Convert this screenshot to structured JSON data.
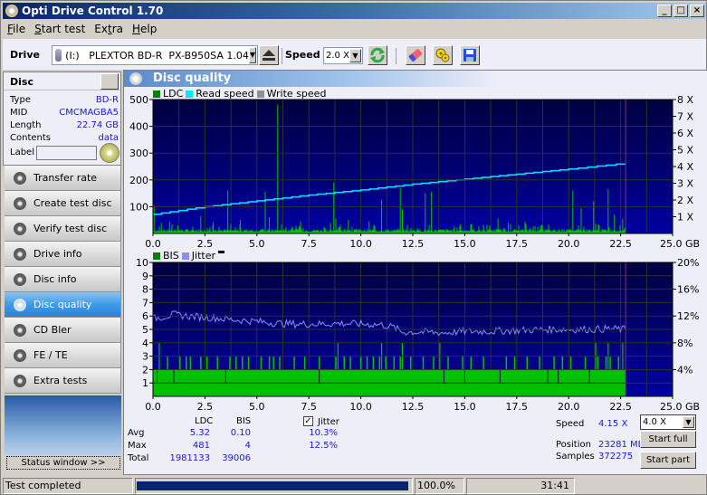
{
  "window": {
    "title": "Opti Drive Control 1.70",
    "controls": [
      "_",
      "□",
      "×"
    ]
  },
  "menu": [
    {
      "label": "File",
      "accel": "F"
    },
    {
      "label": "Start test",
      "accel": "S"
    },
    {
      "label": "Extra",
      "accel": "t"
    },
    {
      "label": "Help",
      "accel": "H"
    }
  ],
  "toolbar": {
    "drive_label": "Drive",
    "drive_value": "(I:)   PLEXTOR BD-R  PX-B950SA 1.04",
    "speed_label": "Speed",
    "speed_value": "2.0 X",
    "icons": [
      "eject-icon",
      "refresh-icon",
      "eraser-icon",
      "settings-icon",
      "save-icon"
    ]
  },
  "disc": {
    "header": "Disc",
    "rows": [
      {
        "key": "Type",
        "value": "BD-R"
      },
      {
        "key": "MID",
        "value": "CMCMAGBA5"
      },
      {
        "key": "Length",
        "value": "22.74 GB"
      },
      {
        "key": "Contents",
        "value": "data"
      }
    ],
    "label_key": "Label",
    "label_value": ""
  },
  "nav": [
    {
      "label": "Transfer rate",
      "active": false
    },
    {
      "label": "Create test disc",
      "active": false
    },
    {
      "label": "Verify test disc",
      "active": false
    },
    {
      "label": "Drive info",
      "active": false
    },
    {
      "label": "Disc info",
      "active": false
    },
    {
      "label": "Disc quality",
      "active": true
    },
    {
      "label": "CD Bler",
      "active": false
    },
    {
      "label": "FE / TE",
      "active": false
    },
    {
      "label": "Extra tests",
      "active": false
    }
  ],
  "status_window_label": "Status window >>",
  "panel_title": "Disc quality",
  "colors": {
    "ldc": "#00c000",
    "read_speed": "#00e8ff",
    "write_speed": "#909090",
    "bis": "#00c000",
    "jitter": "#8c8cff",
    "plot_bg_top": "#000040",
    "plot_bg_bottom": "#0000a0",
    "end_marker": "#a02080",
    "accent": "#3d9ae8"
  },
  "chart_data": [
    {
      "type": "bar",
      "title": "LDC / Read speed",
      "legend": [
        "LDC",
        "Read speed",
        "Write speed"
      ],
      "legend_position": "top-left",
      "xlabel": "GB",
      "xlim": [
        0,
        25
      ],
      "xticks": [
        "0.0",
        "2.5",
        "5.0",
        "7.5",
        "10.0",
        "12.5",
        "15.0",
        "17.5",
        "20.0",
        "22.5",
        "25.0 GB"
      ],
      "ylim_left": [
        0,
        500
      ],
      "yticks_left": [
        "100",
        "200",
        "300",
        "400",
        "500"
      ],
      "ylim_right": [
        0,
        8
      ],
      "yticks_right": [
        "1 X",
        "2 X",
        "3 X",
        "4 X",
        "5 X",
        "6 X",
        "7 X",
        "8 X"
      ],
      "grid": true,
      "data_end_gb": 22.74,
      "ldc_baseline": 12,
      "ldc_spikes": [
        {
          "x": 0.05,
          "y": 105
        },
        {
          "x": 0.4,
          "y": 40
        },
        {
          "x": 0.8,
          "y": 45
        },
        {
          "x": 1.2,
          "y": 30
        },
        {
          "x": 2.3,
          "y": 65
        },
        {
          "x": 2.9,
          "y": 42
        },
        {
          "x": 3.6,
          "y": 160
        },
        {
          "x": 4.2,
          "y": 50
        },
        {
          "x": 5.4,
          "y": 155
        },
        {
          "x": 5.6,
          "y": 60
        },
        {
          "x": 6.0,
          "y": 481
        },
        {
          "x": 7.1,
          "y": 45
        },
        {
          "x": 8.7,
          "y": 190
        },
        {
          "x": 8.8,
          "y": 55
        },
        {
          "x": 9.4,
          "y": 50
        },
        {
          "x": 10.4,
          "y": 45
        },
        {
          "x": 11.0,
          "y": 125
        },
        {
          "x": 11.9,
          "y": 170
        },
        {
          "x": 12.0,
          "y": 90
        },
        {
          "x": 13.1,
          "y": 150
        },
        {
          "x": 13.4,
          "y": 155
        },
        {
          "x": 14.8,
          "y": 35
        },
        {
          "x": 16.6,
          "y": 55
        },
        {
          "x": 17.1,
          "y": 40
        },
        {
          "x": 17.9,
          "y": 45
        },
        {
          "x": 18.7,
          "y": 30
        },
        {
          "x": 20.2,
          "y": 160
        },
        {
          "x": 20.6,
          "y": 95
        },
        {
          "x": 21.2,
          "y": 120
        },
        {
          "x": 21.9,
          "y": 165
        },
        {
          "x": 22.2,
          "y": 70
        },
        {
          "x": 22.6,
          "y": 55
        }
      ],
      "read_speed": [
        {
          "x": 0,
          "y": 1.15
        },
        {
          "x": 2.5,
          "y": 1.6
        },
        {
          "x": 5,
          "y": 1.95
        },
        {
          "x": 7.5,
          "y": 2.3
        },
        {
          "x": 10,
          "y": 2.6
        },
        {
          "x": 12.5,
          "y": 2.95
        },
        {
          "x": 15,
          "y": 3.25
        },
        {
          "x": 17.5,
          "y": 3.55
        },
        {
          "x": 20,
          "y": 3.85
        },
        {
          "x": 22.74,
          "y": 4.2
        }
      ]
    },
    {
      "type": "bar",
      "title": "BIS / Jitter",
      "legend": [
        "BIS",
        "Jitter"
      ],
      "legend_position": "top-left",
      "xlabel": "GB",
      "xlim": [
        0,
        25
      ],
      "xticks": [
        "0.0",
        "2.5",
        "5.0",
        "7.5",
        "10.0",
        "12.5",
        "15.0",
        "17.5",
        "20.0",
        "22.5",
        "25.0 GB"
      ],
      "ylim_left": [
        0,
        10
      ],
      "yticks_left": [
        "1",
        "2",
        "3",
        "4",
        "5",
        "6",
        "7",
        "8",
        "9",
        "10"
      ],
      "ylim_right": [
        0,
        20
      ],
      "yticks_right": [
        "4%",
        "8%",
        "12%",
        "16%",
        "20%"
      ],
      "grid": true,
      "data_end_gb": 22.74,
      "bis_baseline": 2,
      "bis_spikes_3": [
        0.7,
        1.3,
        1.6,
        1.8,
        2.3,
        2.6,
        3.1,
        3.7,
        4.0,
        4.3,
        4.6,
        5.2,
        5.6,
        5.8,
        6.1,
        6.8,
        7.3,
        8.0,
        8.8,
        9.2,
        9.5,
        10.0,
        10.3,
        10.6,
        10.9,
        11.2,
        11.6,
        11.9,
        12.4,
        13.0,
        13.5,
        14.2,
        14.9,
        15.3,
        15.9,
        17.0,
        17.4,
        18.0,
        18.6,
        19.3,
        19.7,
        20.1,
        20.8,
        21.4,
        21.8,
        22.0,
        22.4
      ],
      "bis_spikes_4": [
        0.3,
        8.9,
        11.0,
        12.0,
        13.8,
        21.3,
        21.9,
        22.6
      ],
      "bis_zero_dips": [
        0.2,
        1.0,
        3.5,
        8.0,
        14.0,
        15.0,
        16.7,
        19.0,
        19.5,
        21.0
      ],
      "jitter": [
        {
          "x": 0,
          "y": 11.6
        },
        {
          "x": 1,
          "y": 12.2
        },
        {
          "x": 2,
          "y": 11.9
        },
        {
          "x": 3,
          "y": 11.7
        },
        {
          "x": 4,
          "y": 11.4
        },
        {
          "x": 5,
          "y": 11.2
        },
        {
          "x": 6,
          "y": 10.9
        },
        {
          "x": 7,
          "y": 10.8
        },
        {
          "x": 8,
          "y": 10.8
        },
        {
          "x": 9,
          "y": 10.9
        },
        {
          "x": 10,
          "y": 10.8
        },
        {
          "x": 11,
          "y": 10.7
        },
        {
          "x": 11.6,
          "y": 10.3
        },
        {
          "x": 12,
          "y": 9.6
        },
        {
          "x": 13,
          "y": 9.6
        },
        {
          "x": 14,
          "y": 9.5
        },
        {
          "x": 15,
          "y": 9.7
        },
        {
          "x": 16,
          "y": 9.7
        },
        {
          "x": 17,
          "y": 9.8
        },
        {
          "x": 18,
          "y": 9.9
        },
        {
          "x": 19,
          "y": 10.0
        },
        {
          "x": 20,
          "y": 10.0
        },
        {
          "x": 21,
          "y": 10.0
        },
        {
          "x": 22,
          "y": 10.1
        },
        {
          "x": 22.74,
          "y": 10.0
        }
      ]
    }
  ],
  "stats": {
    "col_ldc": "LDC",
    "col_bis": "BIS",
    "jitter_label": "Jitter",
    "jitter_checked": true,
    "rows": [
      {
        "label": "Avg",
        "ldc": "5.32",
        "bis": "0.10",
        "jitter": "10.3%"
      },
      {
        "label": "Max",
        "ldc": "481",
        "bis": "4",
        "jitter": "12.5%"
      },
      {
        "label": "Total",
        "ldc": "1981133",
        "bis": "39006",
        "jitter": ""
      }
    ]
  },
  "test_info": {
    "speed_label": "Speed",
    "speed_value": "4.15 X",
    "speed_select": "4.0 X",
    "position_label": "Position",
    "position_value": "23281 MB",
    "samples_label": "Samples",
    "samples_value": "372275",
    "start_full": "Start full",
    "start_part": "Start part"
  },
  "statusbar": {
    "status": "Test completed",
    "progress_percent": 100,
    "progress_text": "100.0%",
    "elapsed": "31:41"
  }
}
